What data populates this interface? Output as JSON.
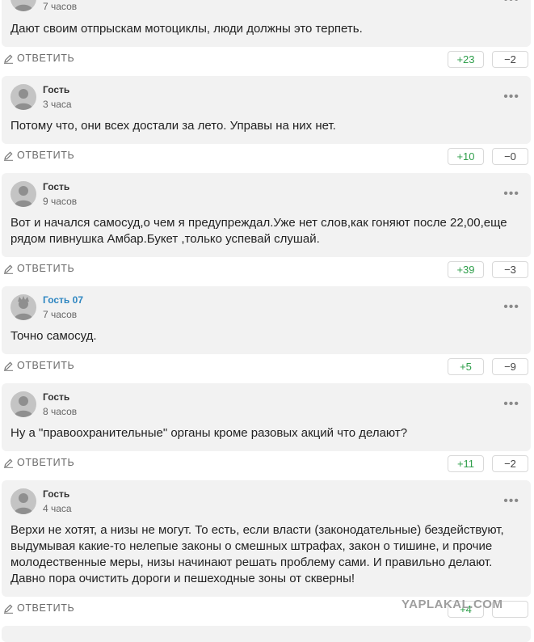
{
  "ui": {
    "reply_label": "ОТВЕТИТЬ",
    "more_label": "•••",
    "upvote_color": "#2e9e4a",
    "username_link_color": "#2e86c1"
  },
  "comments": [
    {
      "author": "",
      "time": "7 часов",
      "text": "Дают своим отпрыскам мотоциклы, люди должны это терпеть.",
      "likes": "+23",
      "dislikes": "−2"
    },
    {
      "author": "Гость",
      "time": "3 часа",
      "text": "Потому что, они всех достали за лето. Управы на них нет.",
      "likes": "+10",
      "dislikes": "−0"
    },
    {
      "author": "Гость",
      "time": "9 часов",
      "text": "Вот и начался самосуд,о чем я предупреждал.Уже нет слов,как гоняют после 22,00,еще\nрядом пивнушка Амбар.Букет ,только успевай слушай.",
      "likes": "+39",
      "dislikes": "−3"
    },
    {
      "author": "Гость 07",
      "time": "7 часов",
      "text": "Точно самосуд.",
      "likes": "+5",
      "dislikes": "−9"
    },
    {
      "author": "Гость",
      "time": "8 часов",
      "text": "Ну а \"правоохранительные\" органы кроме разовых акций что делают?",
      "likes": "+11",
      "dislikes": "−2"
    },
    {
      "author": "Гость",
      "time": "4 часа",
      "text": "Верхи не хотят, а низы не могут. То есть, если власти (законодательные) бездействуют,\nвыдумывая какие-то нелепые законы о смешных штрафах, закон о тишине, и прочие\nмолодественные меры, низы начинают решать проблему сами. И правильно делают.\nДавно пора очистить дороги и пешеходные зоны от скверны!",
      "likes": "+4",
      "dislikes": ""
    }
  ],
  "watermark": "YAPLAKAL.COM"
}
